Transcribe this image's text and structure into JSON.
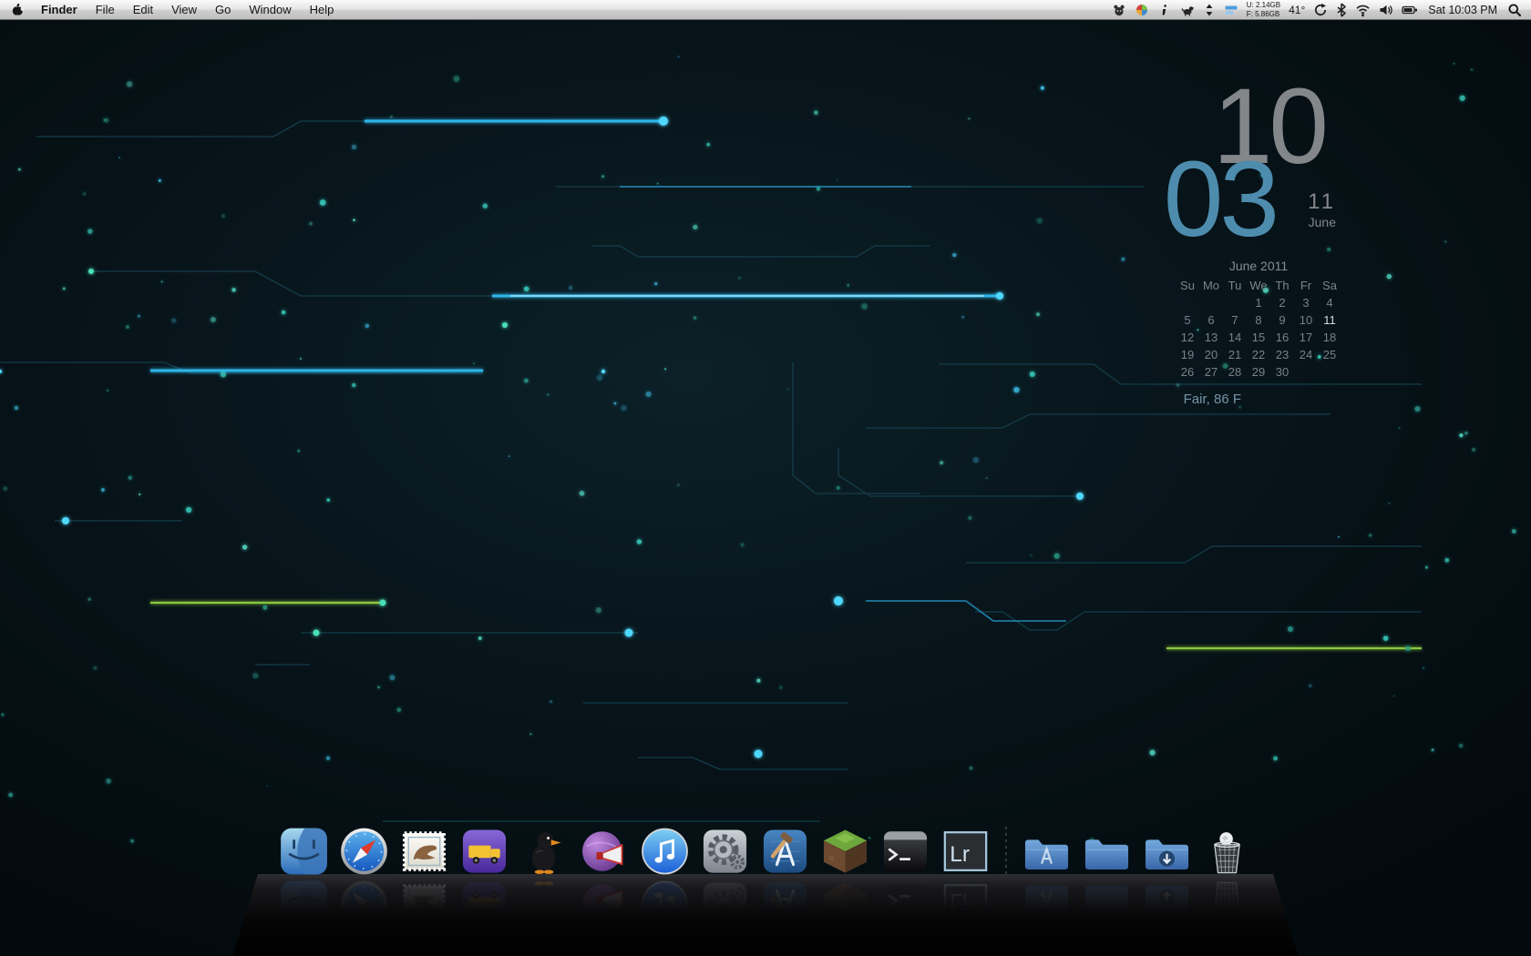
{
  "menu_bar": {
    "app_menus": [
      "Finder",
      "File",
      "Edit",
      "View",
      "Go",
      "Window",
      "Help"
    ],
    "status_icons_left": [
      "critter-icon",
      "pinwheel-icon",
      "info-icon",
      "dog-icon",
      "updown-arrows-icon",
      "meter-icon"
    ],
    "status_icons_right": [
      "sync-icon",
      "bluetooth-icon",
      "wifi-icon",
      "volume-icon",
      "battery-icon"
    ],
    "status": {
      "mem_used": "U: 2.14GB",
      "mem_free": "F: 5.86GB",
      "temperature": "41°",
      "clock": "Sat 10:03 PM"
    }
  },
  "widgets": {
    "clock": {
      "hour": "10",
      "minute": "03",
      "day": "11",
      "month": "June"
    },
    "calendar": {
      "title": "June 2011",
      "day_headers": [
        "Su",
        "Mo",
        "Tu",
        "We",
        "Th",
        "Fr",
        "Sa"
      ],
      "weeks": [
        [
          "",
          "",
          "",
          "1",
          "2",
          "3",
          "4"
        ],
        [
          "5",
          "6",
          "7",
          "8",
          "9",
          "10",
          "11"
        ],
        [
          "12",
          "13",
          "14",
          "15",
          "16",
          "17",
          "18"
        ],
        [
          "19",
          "20",
          "21",
          "22",
          "23",
          "24",
          "25"
        ],
        [
          "26",
          "27",
          "28",
          "29",
          "30",
          "",
          ""
        ]
      ],
      "today": "11"
    },
    "weather": {
      "summary": "Fair, 86 F"
    }
  },
  "dock": {
    "apps": [
      {
        "id": "finder"
      },
      {
        "id": "safari"
      },
      {
        "id": "mail"
      },
      {
        "id": "transmit"
      },
      {
        "id": "duck"
      },
      {
        "id": "megaphone-globe"
      },
      {
        "id": "itunes"
      },
      {
        "id": "system-preferences"
      },
      {
        "id": "xcode"
      },
      {
        "id": "minecraft"
      },
      {
        "id": "terminal"
      },
      {
        "id": "lightroom",
        "text": "Lr"
      },
      {
        "id": "separator"
      },
      {
        "id": "applications-folder"
      },
      {
        "id": "documents-folder"
      },
      {
        "id": "downloads-folder"
      },
      {
        "id": "trash"
      }
    ]
  },
  "colors": {
    "circuit_cyan": "#2fb4e8",
    "circuit_green": "#8cc83e",
    "clock_minute_blue": "#4e8cad",
    "clock_hour_gray": "#83878a"
  }
}
